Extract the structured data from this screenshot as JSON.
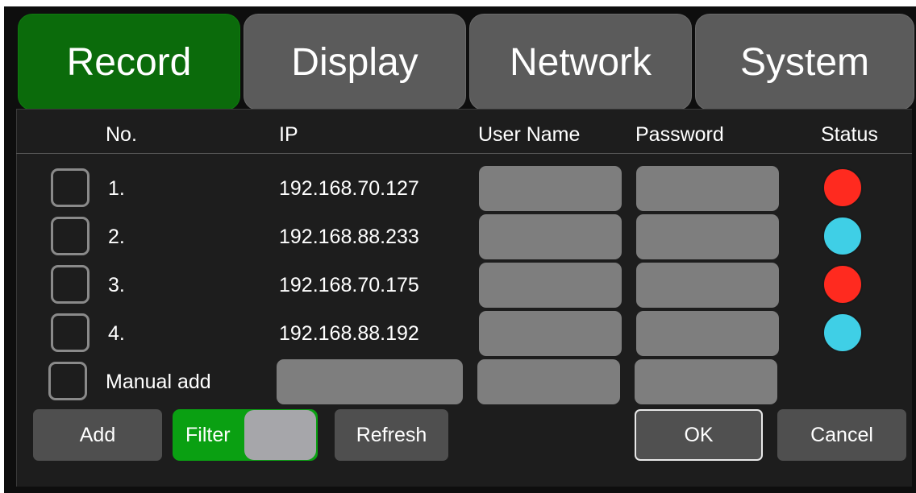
{
  "tabs": [
    {
      "label": "Record",
      "active": true
    },
    {
      "label": "Display",
      "active": false
    },
    {
      "label": "Network",
      "active": false
    },
    {
      "label": "System",
      "active": false
    }
  ],
  "table": {
    "headers": {
      "no": "No.",
      "ip": "IP",
      "user_name": "User Name",
      "password": "Password",
      "status": "Status"
    },
    "rows": [
      {
        "no": "1.",
        "ip": "192.168.70.127",
        "user_name": "",
        "password": "",
        "status": "offline",
        "status_color": "#ff2a1f"
      },
      {
        "no": "2.",
        "ip": "192.168.88.233",
        "user_name": "",
        "password": "",
        "status": "online",
        "status_color": "#3fcfe6"
      },
      {
        "no": "3.",
        "ip": "192.168.70.175",
        "user_name": "",
        "password": "",
        "status": "offline",
        "status_color": "#ff2a1f"
      },
      {
        "no": "4.",
        "ip": "192.168.88.192",
        "user_name": "",
        "password": "",
        "status": "online",
        "status_color": "#3fcfe6"
      }
    ],
    "manual_add": {
      "label": "Manual add",
      "ip": "",
      "user_name": "",
      "password": ""
    }
  },
  "buttons": {
    "add": "Add",
    "filter": "Filter",
    "filter_on": true,
    "refresh": "Refresh",
    "ok": "OK",
    "cancel": "Cancel"
  },
  "colors": {
    "active_tab": "#0b6b0b",
    "filter_on": "#0aa012",
    "status_offline": "#ff2a1f",
    "status_online": "#3fcfe6"
  }
}
